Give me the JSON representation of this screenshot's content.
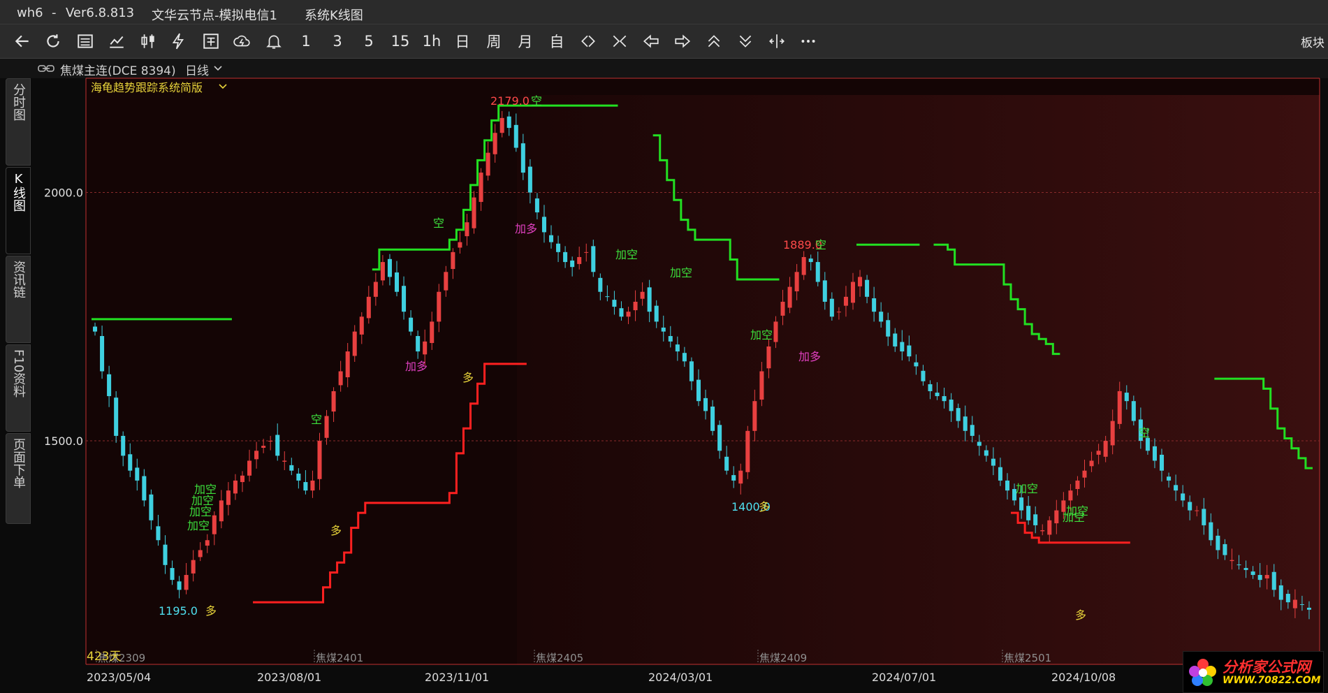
{
  "titlebar": {
    "app": "wh6",
    "sep": "-",
    "version": "Ver6.8.813",
    "server": "文华云节点-模拟电信1",
    "window": "系统K线图"
  },
  "toolbar": {
    "items": [
      {
        "name": "back-button",
        "icon": "arrow-left-icon"
      },
      {
        "name": "refresh-button",
        "icon": "refresh-icon"
      },
      {
        "name": "quote-list-button",
        "icon": "list-icon"
      },
      {
        "name": "timeshare-button",
        "icon": "line-chart-icon"
      },
      {
        "name": "kline-button",
        "icon": "candle-icon"
      },
      {
        "name": "lightning-button",
        "icon": "lightning-icon"
      },
      {
        "name": "order-button",
        "icon": "order-icon"
      },
      {
        "name": "cloud-button",
        "icon": "cloud-icon"
      },
      {
        "name": "alert-button",
        "icon": "bell-icon"
      }
    ],
    "periods": [
      "1",
      "3",
      "5",
      "15",
      "1h",
      "日",
      "周",
      "月",
      "自"
    ],
    "nav_icons": [
      "zoom-out-icon",
      "zoom-in-icon",
      "arrow-left-hollow-icon",
      "arrow-right-hollow-icon",
      "chevron-up-double-icon",
      "chevron-down-double-icon",
      "split-icon",
      "more-icon"
    ],
    "right_label": "板块"
  },
  "infobar": {
    "link_icon": "link-icon",
    "symbol": "焦煤主连(DCE 8394)",
    "period": "日线"
  },
  "left_tabs": [
    "分时图",
    "K线图",
    "资讯链",
    "F10资料",
    "页面下单"
  ],
  "indicator": {
    "name": "海龟趋势跟踪系统简版"
  },
  "colors": {
    "up": "#e84040",
    "down": "#3fd0e0",
    "short_line": "#22e022",
    "long_line": "#ff2020",
    "bg_red": "#3a0f0f",
    "label_yellow": "#e6d23a",
    "label_green": "#3ce03c",
    "label_magenta": "#e040c0"
  },
  "chart_data": {
    "type": "candlestick",
    "title": "焦煤主连(DCE 8394) 日线",
    "y_ticks": [
      2000.0,
      1500.0
    ],
    "y_tick_labels": [
      "2000.0",
      "1500.0"
    ],
    "ylim": [
      1050,
      2230
    ],
    "x_axis_labels": [
      "2023/05/04",
      "2023/08/01",
      "2023/11/01",
      "2024/03/01",
      "2024/07/01",
      "2024/10/08"
    ],
    "contract_labels": [
      "焦煤2309",
      "焦煤2401",
      "焦煤2405",
      "焦煤2409",
      "焦煤2501"
    ],
    "bar_count_label": "423天",
    "price_annotations": [
      {
        "text": "2179.0",
        "value": 2179.0
      },
      {
        "text": "1195.0",
        "value": 1195.0
      },
      {
        "text": "1889.0",
        "value": 1889.0
      },
      {
        "text": "1400.0",
        "value": 1400.0
      }
    ],
    "signals": [
      {
        "text": "空",
        "kind": "short"
      },
      {
        "text": "多",
        "kind": "long"
      },
      {
        "text": "加空",
        "kind": "add-short"
      },
      {
        "text": "加多",
        "kind": "add-long"
      }
    ],
    "close_series": [
      1720,
      1640,
      1590,
      1510,
      1470,
      1440,
      1420,
      1380,
      1340,
      1300,
      1250,
      1220,
      1200,
      1230,
      1260,
      1280,
      1300,
      1350,
      1380,
      1400,
      1420,
      1430,
      1460,
      1480,
      1490,
      1500,
      1470,
      1460,
      1440,
      1420,
      1400,
      1420,
      1500,
      1550,
      1600,
      1640,
      1680,
      1720,
      1750,
      1790,
      1820,
      1860,
      1830,
      1800,
      1760,
      1720,
      1680,
      1700,
      1740,
      1800,
      1840,
      1880,
      1900,
      1940,
      1990,
      2040,
      2080,
      2120,
      2150,
      2130,
      2090,
      2040,
      2000,
      1960,
      1920,
      1900,
      1880,
      1860,
      1850,
      1870,
      1880,
      1840,
      1800,
      1790,
      1770,
      1750,
      1760,
      1780,
      1800,
      1760,
      1740,
      1720,
      1700,
      1680,
      1660,
      1620,
      1580,
      1560,
      1520,
      1480,
      1440,
      1420,
      1440,
      1520,
      1580,
      1640,
      1690,
      1740,
      1780,
      1810,
      1840,
      1870,
      1860,
      1820,
      1780,
      1750,
      1760,
      1790,
      1820,
      1830,
      1790,
      1760,
      1740,
      1710,
      1690,
      1680,
      1670,
      1650,
      1620,
      1600,
      1590,
      1580,
      1560,
      1540,
      1520,
      1510,
      1490,
      1470,
      1450,
      1420,
      1400,
      1380,
      1360,
      1340,
      1330,
      1320,
      1340,
      1360,
      1380,
      1400,
      1420,
      1440,
      1460,
      1480,
      1500,
      1540,
      1600,
      1580,
      1540,
      1500,
      1480,
      1460,
      1440,
      1420,
      1400,
      1380,
      1360,
      1360,
      1330,
      1300,
      1280,
      1270,
      1260,
      1250,
      1240,
      1230,
      1220,
      1230,
      1200,
      1180,
      1175,
      1180,
      1170,
      1160
    ]
  }
}
